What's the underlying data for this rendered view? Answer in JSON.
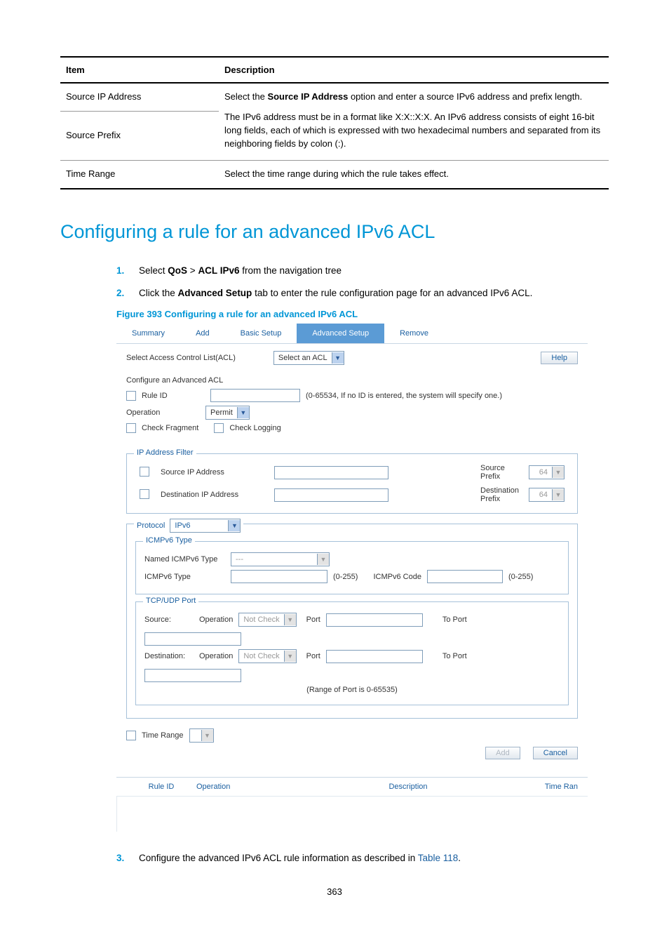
{
  "table": {
    "head": {
      "item": "Item",
      "desc": "Description"
    },
    "rows": [
      {
        "item": "Source IP Address",
        "desc_html": "Select the <b>Source IP Address</b> option and enter a source IPv6 address and prefix length."
      },
      {
        "item": "Source Prefix",
        "desc_html": "The IPv6 address must be in a format like X:X::X:X. An IPv6 address consists of eight 16-bit long fields, each of which is expressed with two hexadecimal numbers and separated from its neighboring fields by colon (:)."
      },
      {
        "item": "Time Range",
        "desc_html": "Select the time range during which the rule takes effect."
      }
    ]
  },
  "heading": "Configuring a rule for an advanced IPv6 ACL",
  "steps": {
    "s1": {
      "num": "1.",
      "html": "Select <b>QoS</b> > <b>ACL IPv6</b> from the navigation tree"
    },
    "s2": {
      "num": "2.",
      "html": "Click the <b>Advanced Setup</b> tab to enter the rule configuration page for an advanced IPv6 ACL."
    },
    "s3": {
      "num": "3.",
      "pre": "Configure the advanced IPv6 ACL rule information as described in ",
      "link": "Table 118",
      "post": "."
    }
  },
  "figure_caption": "Figure 393 Configuring a rule for an advanced IPv6 ACL",
  "ss": {
    "tabs": [
      "Summary",
      "Add",
      "Basic Setup",
      "Advanced Setup",
      "Remove"
    ],
    "active_tab": 3,
    "sel_acl_label": "Select Access Control List(ACL)",
    "sel_acl_value": "Select an ACL",
    "help": "Help",
    "section_title": "Configure an Advanced ACL",
    "rule_id": "Rule ID",
    "rule_hint": "(0-65534, If no ID is entered, the system will specify one.)",
    "operation": "Operation",
    "op_value": "Permit",
    "check_fragment": "Check Fragment",
    "check_logging": "Check Logging",
    "ip_filter": "IP Address Filter",
    "src_ip": "Source IP Address",
    "dst_ip": "Destination IP Address",
    "src_prefix": "Source Prefix",
    "dst_prefix": "Destination Prefix",
    "prefix_value": "64",
    "protocol": "Protocol",
    "protocol_value": "IPv6",
    "icmp_group": "ICMPv6 Type",
    "named_icmp": "Named ICMPv6 Type",
    "named_icmp_value": "---",
    "icmp_type": "ICMPv6 Type",
    "icmp_range": "(0-255)",
    "icmp_code": "ICMPv6 Code",
    "tcp_group": "TCP/UDP Port",
    "tcp_source": "Source:",
    "tcp_dest": "Destination:",
    "tcp_operation": "Operation",
    "not_check": "Not Check",
    "port": "Port",
    "to_port": "To Port",
    "port_range": "(Range of Port is 0-65535)",
    "time_range": "Time Range",
    "add": "Add",
    "cancel": "Cancel",
    "results": [
      "Rule ID",
      "Operation",
      "Description",
      "Time Ran"
    ]
  },
  "page_num": "363"
}
